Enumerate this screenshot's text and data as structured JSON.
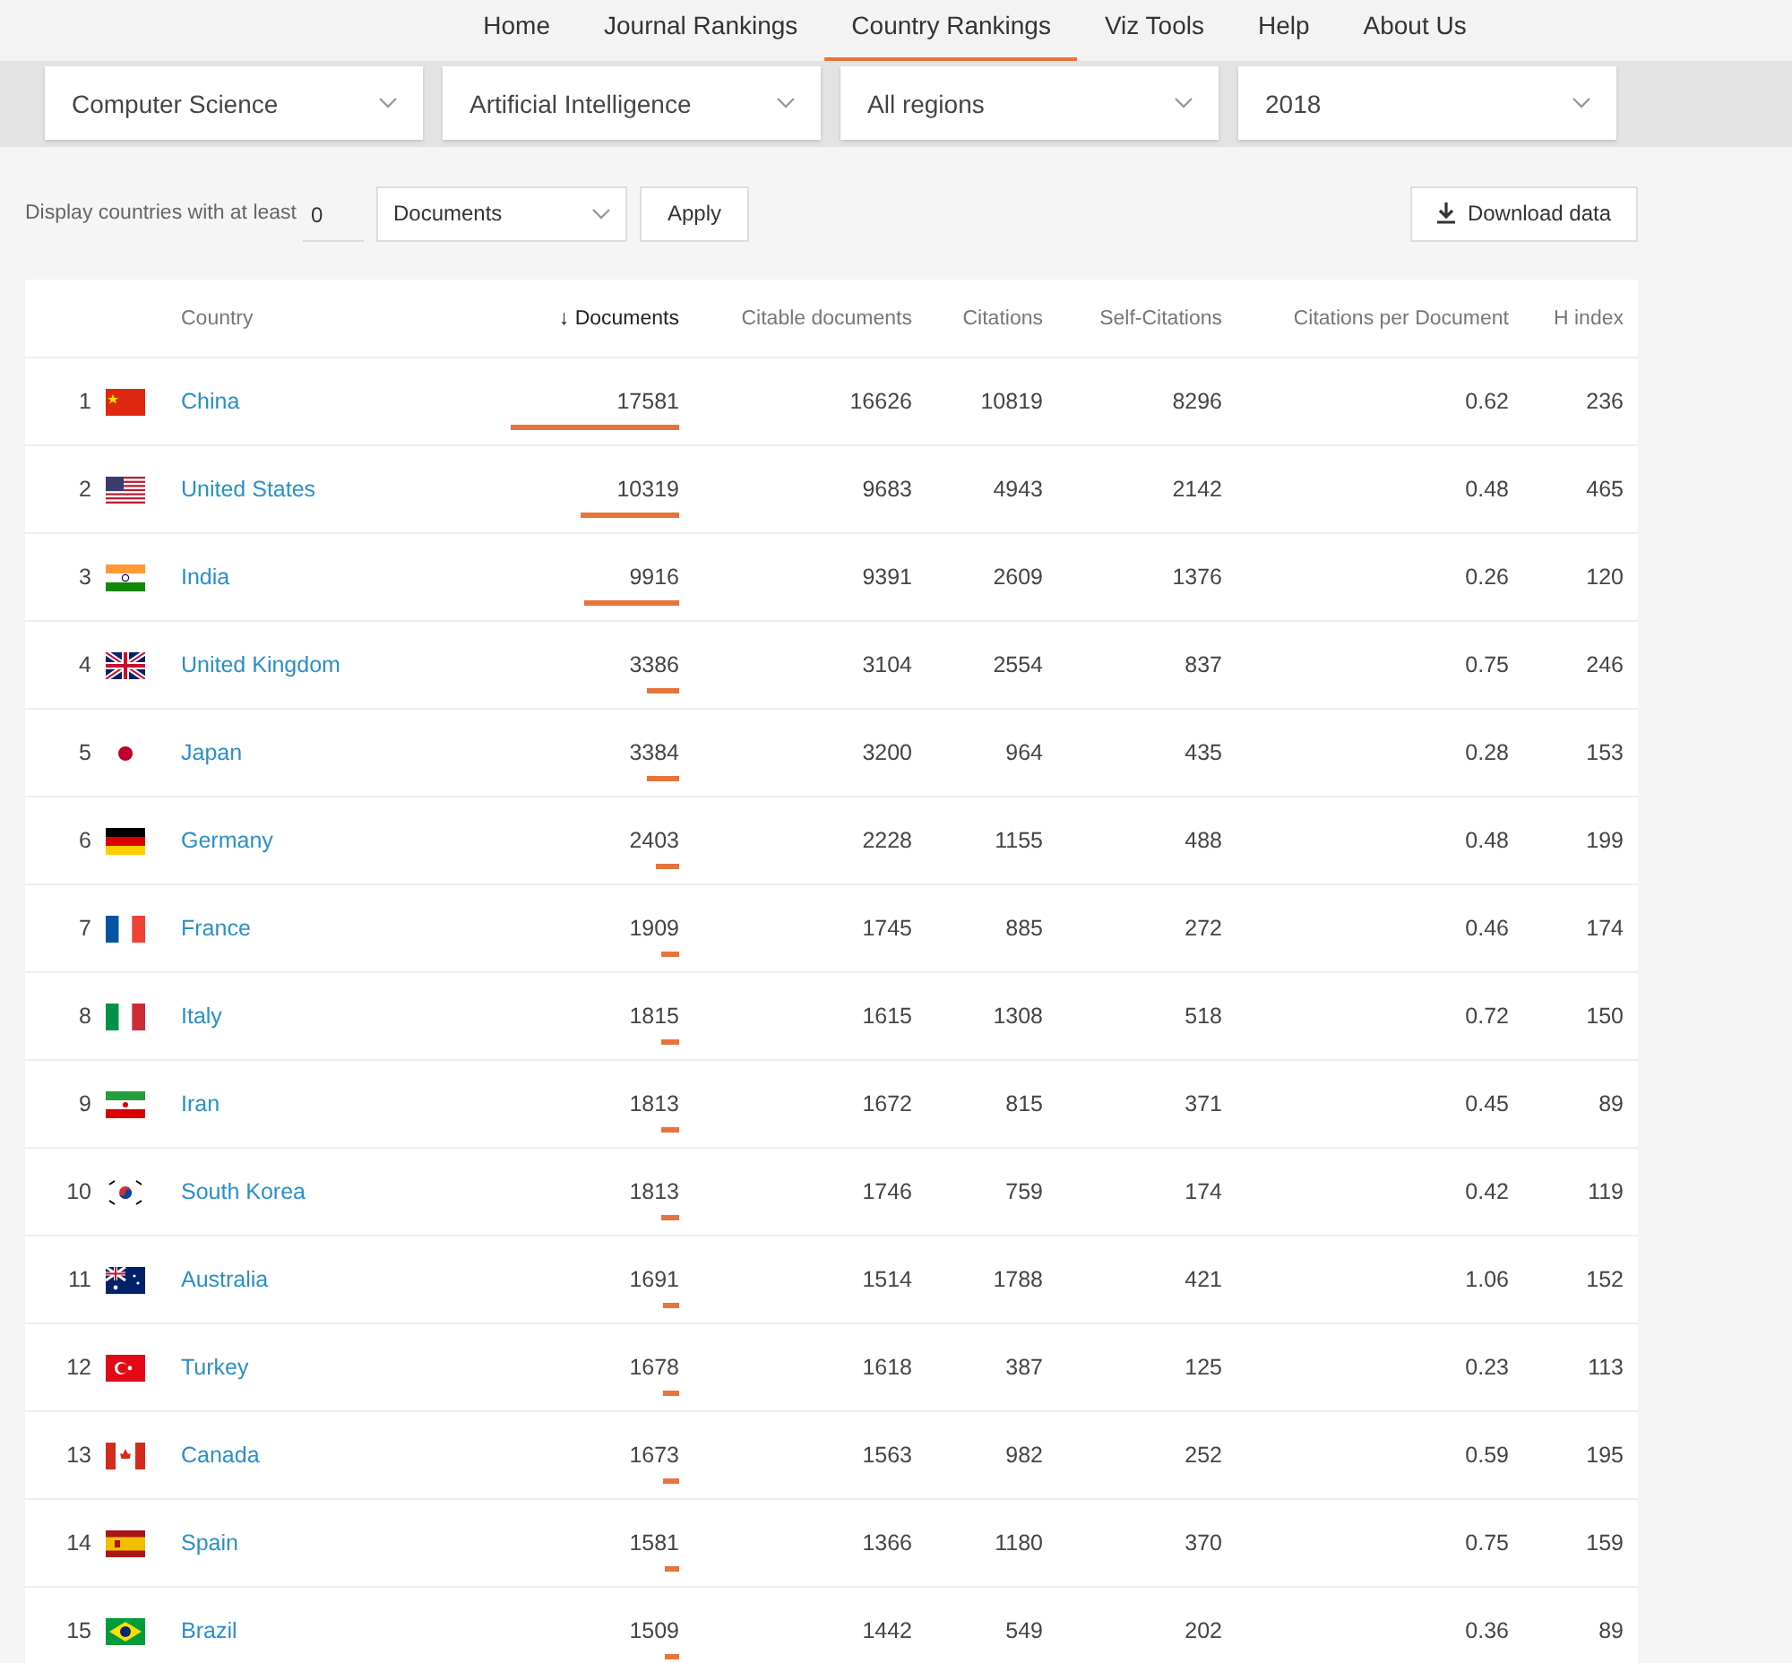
{
  "nav": [
    {
      "label": "Home",
      "selected": false
    },
    {
      "label": "Journal Rankings",
      "selected": false
    },
    {
      "label": "Country Rankings",
      "selected": true
    },
    {
      "label": "Viz Tools",
      "selected": false
    },
    {
      "label": "Help",
      "selected": false
    },
    {
      "label": "About Us",
      "selected": false
    }
  ],
  "filters": [
    {
      "value": "Computer Science"
    },
    {
      "value": "Artificial Intelligence"
    },
    {
      "value": "All regions"
    },
    {
      "value": "2018"
    }
  ],
  "threshold": {
    "label": "Display countries with at least",
    "value": "0",
    "metric": "Documents",
    "apply": "Apply",
    "download": "Download data"
  },
  "table": {
    "sort_arrow": "↓",
    "columns": [
      {
        "label": "Country"
      },
      {
        "label": "Documents",
        "sorted": true
      },
      {
        "label": "Citable documents",
        "sorted": false
      },
      {
        "label": "Citations",
        "sorted": false
      },
      {
        "label": "Self-Citations",
        "sorted": false
      },
      {
        "label": "Citations per Document",
        "sorted": false
      },
      {
        "label": "H index",
        "sorted": false
      }
    ],
    "rows": [
      {
        "rank": "1",
        "country": "China",
        "documents": "17581",
        "citable": "16626",
        "citations": "10819",
        "self": "8296",
        "cpd": "0.62",
        "h": "236"
      },
      {
        "rank": "2",
        "country": "United States",
        "documents": "10319",
        "citable": "9683",
        "citations": "4943",
        "self": "2142",
        "cpd": "0.48",
        "h": "465"
      },
      {
        "rank": "3",
        "country": "India",
        "documents": "9916",
        "citable": "9391",
        "citations": "2609",
        "self": "1376",
        "cpd": "0.26",
        "h": "120"
      },
      {
        "rank": "4",
        "country": "United Kingdom",
        "documents": "3386",
        "citable": "3104",
        "citations": "2554",
        "self": "837",
        "cpd": "0.75",
        "h": "246"
      },
      {
        "rank": "5",
        "country": "Japan",
        "documents": "3384",
        "citable": "3200",
        "citations": "964",
        "self": "435",
        "cpd": "0.28",
        "h": "153"
      },
      {
        "rank": "6",
        "country": "Germany",
        "documents": "2403",
        "citable": "2228",
        "citations": "1155",
        "self": "488",
        "cpd": "0.48",
        "h": "199"
      },
      {
        "rank": "7",
        "country": "France",
        "documents": "1909",
        "citable": "1745",
        "citations": "885",
        "self": "272",
        "cpd": "0.46",
        "h": "174"
      },
      {
        "rank": "8",
        "country": "Italy",
        "documents": "1815",
        "citable": "1615",
        "citations": "1308",
        "self": "518",
        "cpd": "0.72",
        "h": "150"
      },
      {
        "rank": "9",
        "country": "Iran",
        "documents": "1813",
        "citable": "1672",
        "citations": "815",
        "self": "371",
        "cpd": "0.45",
        "h": "89"
      },
      {
        "rank": "10",
        "country": "South Korea",
        "documents": "1813",
        "citable": "1746",
        "citations": "759",
        "self": "174",
        "cpd": "0.42",
        "h": "119"
      },
      {
        "rank": "11",
        "country": "Australia",
        "documents": "1691",
        "citable": "1514",
        "citations": "1788",
        "self": "421",
        "cpd": "1.06",
        "h": "152"
      },
      {
        "rank": "12",
        "country": "Turkey",
        "documents": "1678",
        "citable": "1618",
        "citations": "387",
        "self": "125",
        "cpd": "0.23",
        "h": "113"
      },
      {
        "rank": "13",
        "country": "Canada",
        "documents": "1673",
        "citable": "1563",
        "citations": "982",
        "self": "252",
        "cpd": "0.59",
        "h": "195"
      },
      {
        "rank": "14",
        "country": "Spain",
        "documents": "1581",
        "citable": "1366",
        "citations": "1180",
        "self": "370",
        "cpd": "0.75",
        "h": "159"
      },
      {
        "rank": "15",
        "country": "Brazil",
        "documents": "1509",
        "citable": "1442",
        "citations": "549",
        "self": "202",
        "cpd": "0.36",
        "h": "89"
      }
    ]
  }
}
